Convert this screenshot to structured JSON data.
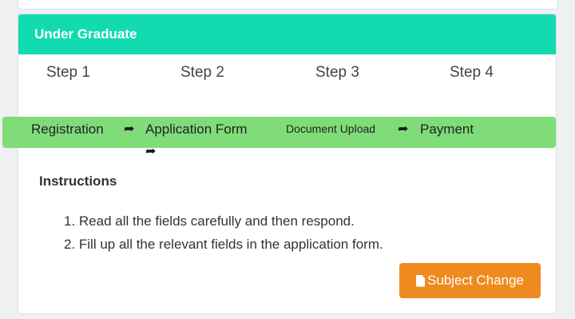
{
  "panel": {
    "title": "Under Graduate"
  },
  "steps": [
    "Step 1",
    "Step 2",
    "Step 3",
    "Step 4"
  ],
  "phases": {
    "registration": "Registration",
    "application_form": "Application Form",
    "document_upload": "Document Upload",
    "payment": "Payment"
  },
  "icons": {
    "arrow": "share-arrow-icon",
    "document": "file-icon"
  },
  "colors": {
    "heading": "#12dbb0",
    "progress": "#7fdc78",
    "button": "#ef8a1e"
  },
  "instructions": {
    "title": "Instructions",
    "items": [
      "1. Read all the fields carefully and then respond.",
      "2. Fill up all the relevant fields in the application form."
    ]
  },
  "button": {
    "label": "Subject Change"
  }
}
